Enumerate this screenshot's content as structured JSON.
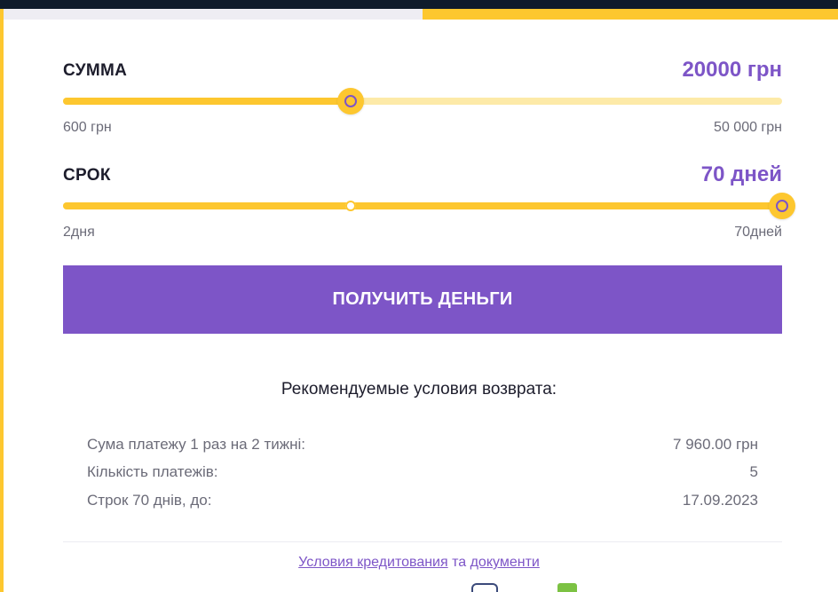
{
  "amount": {
    "label": "СУММА",
    "value": "20000 грн",
    "min_label": "600 грн",
    "max_label": "50 000 грн",
    "min": 600,
    "max": 50000,
    "current": 20000
  },
  "term": {
    "label": "СРОК",
    "value": "70 дней",
    "min_label": "2дня",
    "max_label": "70дней",
    "min": 2,
    "max": 70,
    "current": 70,
    "tick": 28
  },
  "cta": {
    "label": "ПОЛУЧИТЬ ДЕНЬГИ"
  },
  "recommended": {
    "title": "Рекомендуемые условия возврата:",
    "rows": [
      {
        "key": "Сума платежу 1 раз на 2 тижні:",
        "value": "7 960.00 грн"
      },
      {
        "key": "Кількість платежів:",
        "value": "5"
      },
      {
        "key": "Строк 70 днів, до:",
        "value": "17.09.2023"
      }
    ]
  },
  "footer": {
    "link1": "Условия кредитования",
    "connector": " та ",
    "link2": "документи"
  },
  "colors": {
    "accent": "#7d55c7",
    "slider": "#fdc72f",
    "slider_track": "#fdeaa8",
    "header_dark": "#0f1b2b"
  }
}
